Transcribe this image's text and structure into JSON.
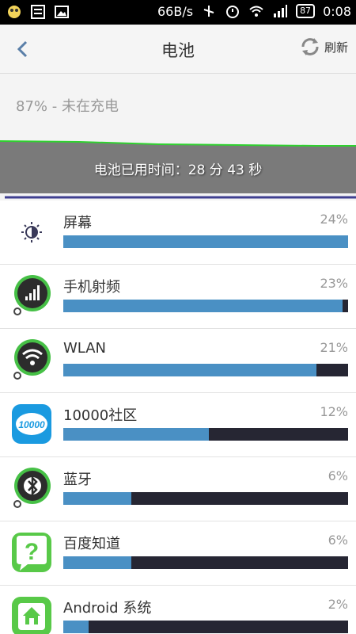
{
  "status_bar": {
    "speed": "66B/s",
    "battery_level": "87",
    "time": "0:08"
  },
  "header": {
    "title": "电池",
    "refresh_label": "刷新"
  },
  "charge_status": "87% - 未在充电",
  "graph": {
    "usage_text": "电池已用时间：28 分 43 秒"
  },
  "apps": [
    {
      "label": "屏幕",
      "percent_text": "24%",
      "fill": 1.0,
      "icon": "brightness-icon"
    },
    {
      "label": "手机射频",
      "percent_text": "23%",
      "fill": 0.98,
      "icon": "cell-signal-icon"
    },
    {
      "label": "WLAN",
      "percent_text": "21%",
      "fill": 0.89,
      "icon": "wifi-icon"
    },
    {
      "label": "10000社区",
      "percent_text": "12%",
      "fill": 0.51,
      "icon": "community-app-icon",
      "icon_text": "10000"
    },
    {
      "label": "蓝牙",
      "percent_text": "6%",
      "fill": 0.24,
      "icon": "bluetooth-icon"
    },
    {
      "label": "百度知道",
      "percent_text": "6%",
      "fill": 0.24,
      "icon": "baidu-zhidao-icon"
    },
    {
      "label": "Android 系统",
      "percent_text": "2%",
      "fill": 0.09,
      "icon": "android-system-icon"
    }
  ],
  "colors": {
    "bar_fill": "#4a90c4",
    "bar_track": "#262633",
    "graph_bg": "#7a7a7a",
    "graph_line": "#2fd12f"
  }
}
